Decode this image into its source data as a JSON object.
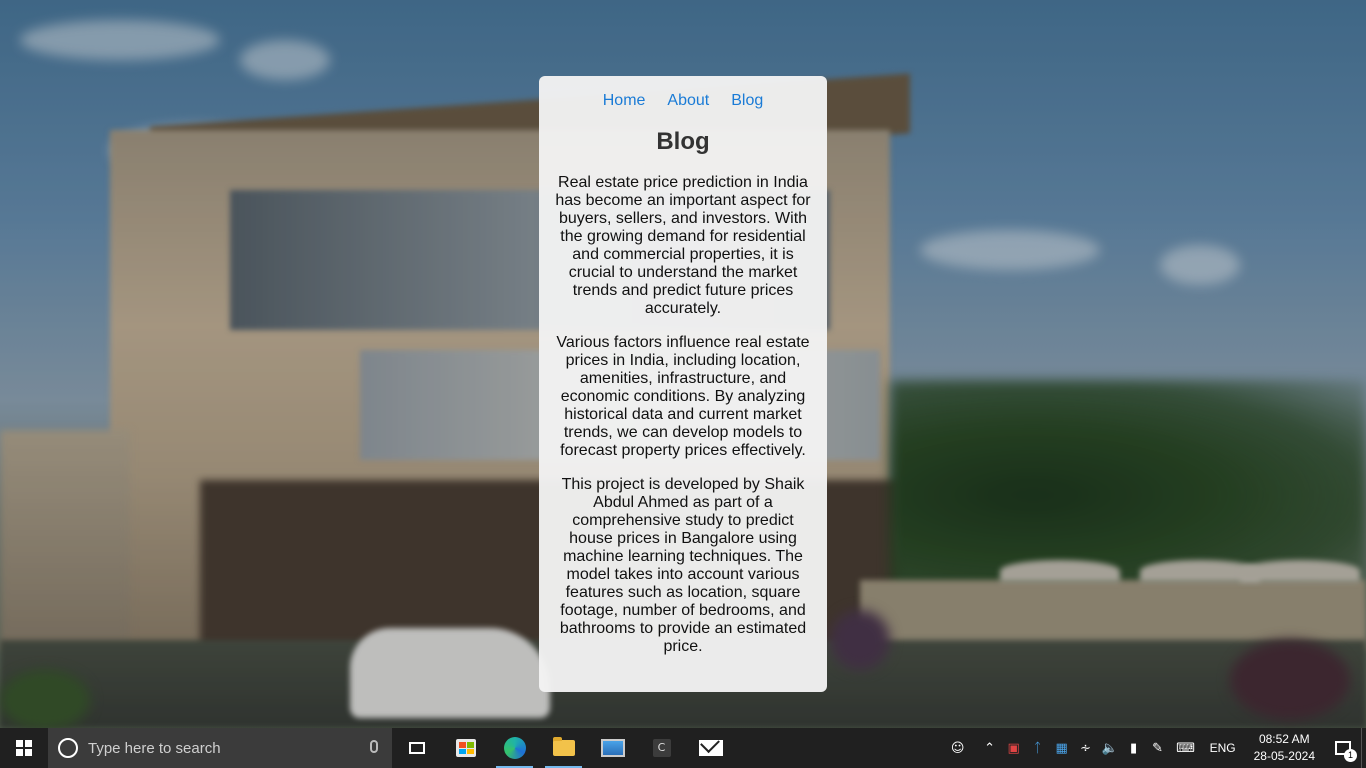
{
  "nav": {
    "home": "Home",
    "about": "About",
    "blog": "Blog"
  },
  "page": {
    "title": "Blog",
    "paragraphs": [
      "Real estate price prediction in India has become an important aspect for buyers, sellers, and investors. With the growing demand for residential and commercial properties, it is crucial to understand the market trends and predict future prices accurately.",
      "Various factors influence real estate prices in India, including location, amenities, infrastructure, and economic conditions. By analyzing historical data and current market trends, we can develop models to forecast property prices effectively.",
      "This project is developed by Shaik Abdul Ahmed as part of a comprehensive study to predict house prices in Bangalore using machine learning techniques. The model takes into account various features such as location, square footage, number of bedrooms, and bathrooms to provide an estimated price."
    ]
  },
  "taskbar": {
    "search_placeholder": "Type here to search",
    "cmd_label": "C",
    "language": "ENG",
    "time": "08:52 AM",
    "date": "28-05-2024",
    "notification_count": "1"
  },
  "colors": {
    "link": "#1a7bd6",
    "taskbar": "#202020",
    "card": "#f2f2f2"
  },
  "icons": [
    "windows-icon",
    "cortana-icon",
    "mic-icon",
    "task-view-icon",
    "store-icon",
    "edge-icon",
    "file-explorer-icon",
    "remote-desktop-icon",
    "terminal-icon",
    "mail-icon",
    "people-icon",
    "chevron-up-icon",
    "security-icon",
    "bluetooth-icon",
    "app-tray-icon",
    "wifi-icon",
    "volume-icon",
    "battery-icon",
    "pen-icon",
    "keyboard-icon",
    "notification-icon"
  ]
}
